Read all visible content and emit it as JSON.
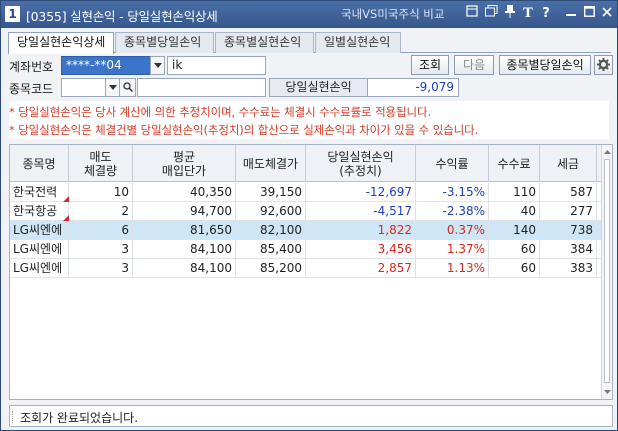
{
  "titlebar": {
    "window_number": "1",
    "title": "[0355] 실현손익 - 당일실현손익상세",
    "right_label": "국내VS미국주식 비교",
    "icons": [
      "restore-layout-icon",
      "copy-window-icon",
      "pin-icon",
      "font-size-icon",
      "help-icon",
      "minimize-icon",
      "maximize-icon",
      "close-icon"
    ],
    "font_icon_text": "T",
    "help_icon_text": "?"
  },
  "tabs": [
    {
      "label": "당일실현손익상세",
      "active": true
    },
    {
      "label": "종목별당일손익",
      "active": false
    },
    {
      "label": "종목별실현손익",
      "active": false
    },
    {
      "label": "일별실현손익",
      "active": false
    }
  ],
  "form": {
    "account_label": "계좌번호",
    "account_value": "****-**04",
    "account_name": "ik",
    "query_button": "조회",
    "next_button": "다음",
    "by_stock_button": "종목별당일손익",
    "stock_code_label": "종목코드",
    "stock_code_value": "",
    "stock_name_value": "",
    "realized_label": "당일실현손익",
    "realized_value": "-9,079"
  },
  "notes": [
    "* 당일실현손익은 당사 계산에 의한 추정치이며, 수수료는 체결시 수수료률로 적용됩니다.",
    "* 당일실현손익은 체결건별 당일실현손익(추정치)의 합산으로 실제손익과 차이가 있을 수 있습니다."
  ],
  "table": {
    "headers": [
      "종목명",
      "매도\n체결량",
      "평균\n매입단가",
      "매도체결가",
      "당일실현손익\n(추정치)",
      "수익률",
      "수수료",
      "세금"
    ],
    "rows": [
      {
        "name": "한국전력",
        "qty": "10",
        "avg_price": "40,350",
        "sell_price": "39,150",
        "pnl": "-12,697",
        "rate": "-3.15%",
        "fee": "110",
        "tax": "587",
        "sign": "neg",
        "flag": true,
        "selected": false
      },
      {
        "name": "한국항공",
        "qty": "2",
        "avg_price": "94,700",
        "sell_price": "92,600",
        "pnl": "-4,517",
        "rate": "-2.38%",
        "fee": "40",
        "tax": "277",
        "sign": "neg",
        "flag": true,
        "selected": false
      },
      {
        "name": "LG씨엔에",
        "qty": "6",
        "avg_price": "81,650",
        "sell_price": "82,100",
        "pnl": "1,822",
        "rate": "0.37%",
        "fee": "140",
        "tax": "738",
        "sign": "pos",
        "flag": false,
        "selected": true
      },
      {
        "name": "LG씨엔에",
        "qty": "3",
        "avg_price": "84,100",
        "sell_price": "85,400",
        "pnl": "3,456",
        "rate": "1.37%",
        "fee": "60",
        "tax": "384",
        "sign": "pos",
        "flag": false,
        "selected": false
      },
      {
        "name": "LG씨엔에",
        "qty": "3",
        "avg_price": "84,100",
        "sell_price": "85,200",
        "pnl": "2,857",
        "rate": "1.13%",
        "fee": "60",
        "tax": "383",
        "sign": "pos",
        "flag": false,
        "selected": false
      }
    ]
  },
  "status": {
    "message": "조회가 완료되었습니다."
  },
  "colors": {
    "titlebar": "#3f63a0",
    "negative": "#1d3fc0",
    "positive": "#d8281e",
    "note": "#d43c2a",
    "selected_row": "#cfe6f6"
  }
}
